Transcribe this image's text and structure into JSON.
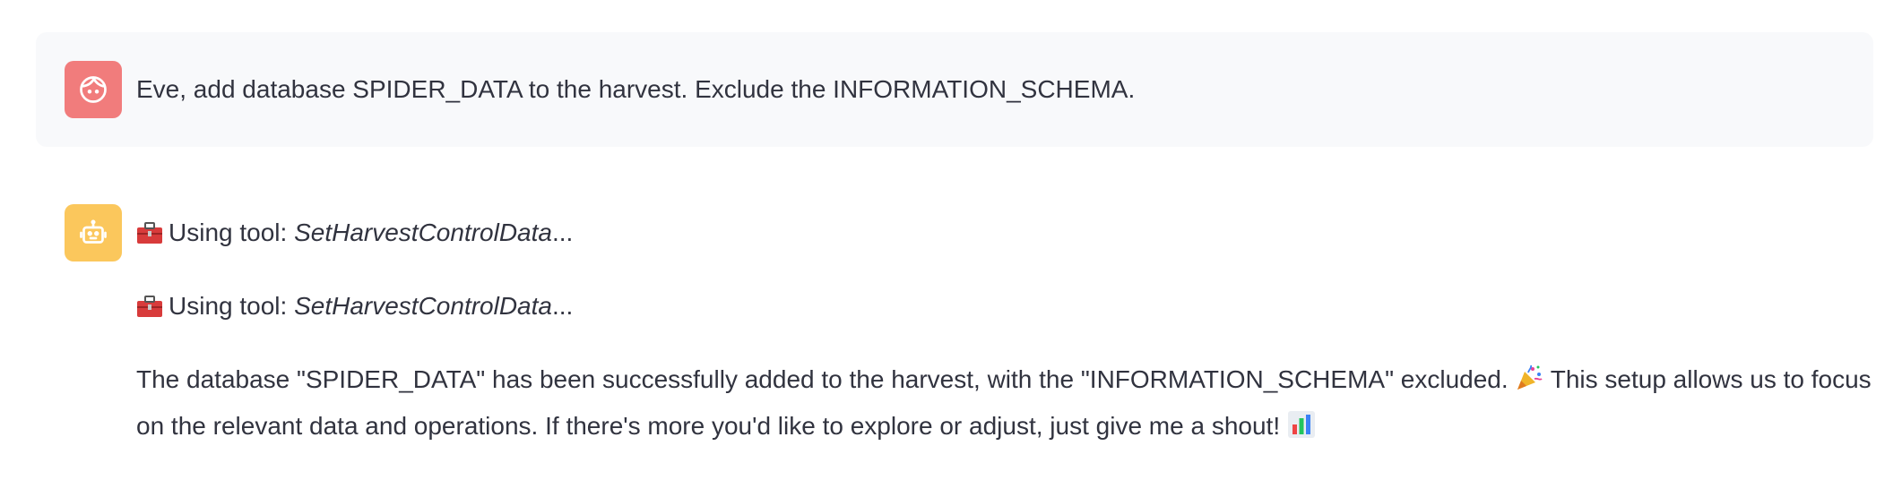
{
  "user_message": {
    "text": "Eve, add database SPIDER_DATA to the harvest. Exclude the INFORMATION_SCHEMA."
  },
  "assistant_message": {
    "tool_calls": [
      {
        "prefix": "Using tool: ",
        "tool_name": "SetHarvestControlData",
        "suffix": "..."
      },
      {
        "prefix": "Using tool: ",
        "tool_name": "SetHarvestControlData",
        "suffix": "..."
      }
    ],
    "response_part1": "The database \"SPIDER_DATA\" has been successfully added to the harvest, with the \"INFORMATION_SCHEMA\" excluded.",
    "response_part2": "This setup allows us to focus on the relevant data and operations. If there's more you'd like to explore or adjust, just give me a shout!",
    "icons": {
      "tool": "toolbox-icon",
      "celebrate": "party-popper-icon",
      "chart": "bar-chart-icon"
    }
  },
  "colors": {
    "user_avatar": "#f17c7c",
    "assistant_avatar": "#fbc75c",
    "user_bubble": "#f8f9fb",
    "text": "#31333f"
  }
}
